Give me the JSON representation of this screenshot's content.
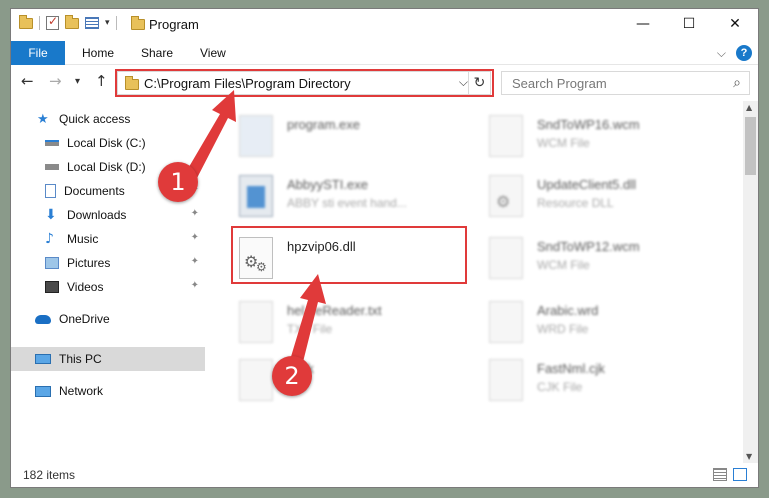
{
  "window": {
    "title": "Program",
    "minimize": "—",
    "maximize": "☐",
    "close": "✕"
  },
  "ribbon": {
    "tabs": [
      "File",
      "Home",
      "Share",
      "View"
    ]
  },
  "nav": {
    "back": "←",
    "forward": "→",
    "recent": "▾",
    "up": "↑"
  },
  "address": {
    "path": "C:\\Program Files\\Program Directory"
  },
  "search": {
    "placeholder": "Search Program"
  },
  "sidebar": {
    "items": [
      {
        "label": "Quick access"
      },
      {
        "label": "Local Disk (C:)"
      },
      {
        "label": "Local Disk (D:)"
      },
      {
        "label": "Documents"
      },
      {
        "label": "Downloads"
      },
      {
        "label": "Music"
      },
      {
        "label": "Pictures"
      },
      {
        "label": "Videos"
      },
      {
        "label": "OneDrive"
      },
      {
        "label": "This PC"
      },
      {
        "label": "Network"
      }
    ]
  },
  "files": [
    {
      "name": "program.exe",
      "type": ""
    },
    {
      "name": "SndToWP16.wcm",
      "type": "WCM File"
    },
    {
      "name": "AbbyySTI.exe",
      "type": "ABBY sti event hand..."
    },
    {
      "name": "UpdateClient5.dll",
      "type": "Resource DLL"
    },
    {
      "name": "hpzvip06.dll",
      "type": ""
    },
    {
      "name": "SndToWP12.wcm",
      "type": "WCM File"
    },
    {
      "name": "hel...eReader.txt",
      "type": "TXT File"
    },
    {
      "name": "Arabic.wrd",
      "type": "WRD File"
    },
    {
      "name": "...cjk",
      "type": "...le"
    },
    {
      "name": "FastNml.cjk",
      "type": "CJK File"
    }
  ],
  "status": {
    "count": "182 items"
  },
  "callouts": [
    "1",
    "2"
  ],
  "colors": {
    "accent": "#1979ca",
    "highlight": "#e03a3a"
  }
}
